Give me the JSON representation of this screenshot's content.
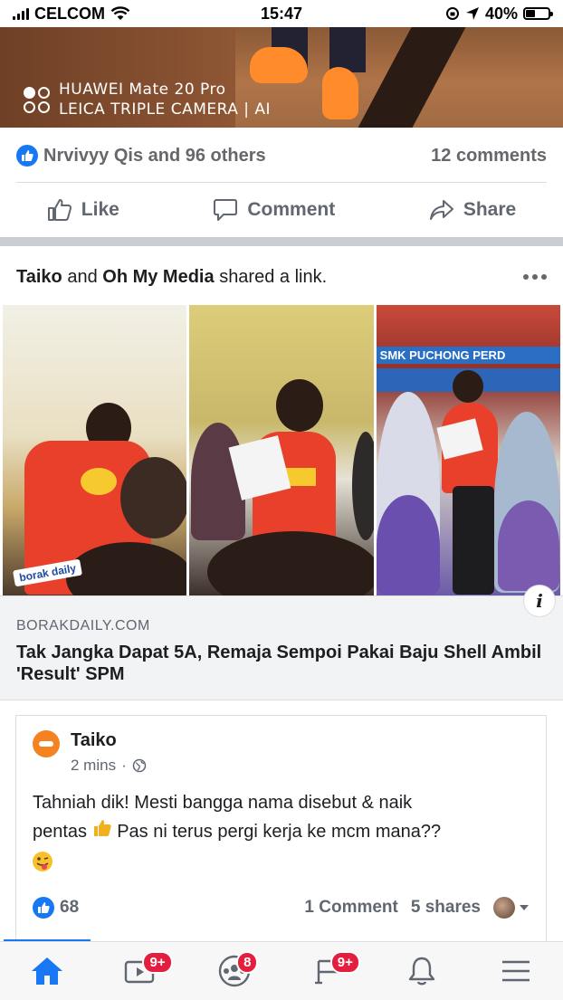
{
  "status_bar": {
    "carrier": "CELCOM",
    "time": "15:47",
    "battery": "40%",
    "battery_level": 0.4
  },
  "top_photo": {
    "camera_line1": "HUAWEI Mate 20 Pro",
    "camera_line2": "LEICA TRIPLE CAMERA | AI"
  },
  "prev_post": {
    "reactions_text": "Nrvivyy Qis and 96 others",
    "comments_text": "12 comments",
    "actions": {
      "like": "Like",
      "comment": "Comment",
      "share": "Share"
    }
  },
  "shared_post": {
    "actor1": "Taiko",
    "connector": "and",
    "actor2": "Oh My Media",
    "verb": "shared a link.",
    "photo_tag": "borak daily",
    "link_domain": "BORAKDAILY.COM",
    "link_title": "Tak Jangka Dapat 5A, Remaja Sempoi Pakai Baju Shell Ambil 'Result' SPM",
    "banner_text": "SMK PUCHONG PERD",
    "embedded": {
      "name": "Taiko",
      "time": "2 mins",
      "text_line1": "Tahniah dik! Mesti bangga nama disebut & naik",
      "text_line2a": "pentas",
      "text_line2b": "Pas ni terus pergi kerja ke mcm mana??",
      "likes": "68",
      "comments": "1 Comment",
      "shares": "5 shares"
    }
  },
  "tabbar": {
    "video_badge": "9+",
    "groups_badge": "8",
    "marketplace_badge": "9+"
  },
  "colors": {
    "fb_blue": "#1877f2",
    "badge_red": "#e41e3f"
  }
}
